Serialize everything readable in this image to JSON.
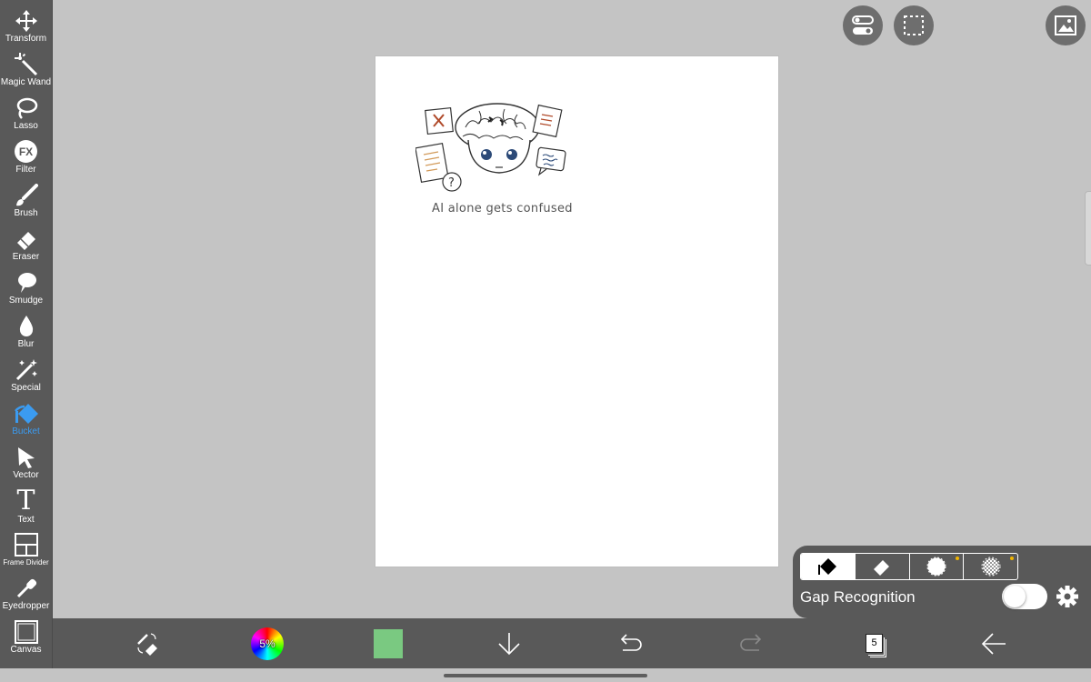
{
  "toolbar": {
    "items": [
      {
        "label": "Transform",
        "icon": "move-arrows-icon"
      },
      {
        "label": "Magic Wand",
        "icon": "magic-wand-icon"
      },
      {
        "label": "Lasso",
        "icon": "lasso-icon"
      },
      {
        "label": "Filter",
        "icon": "fx-icon"
      },
      {
        "label": "Brush",
        "icon": "brush-icon"
      },
      {
        "label": "Eraser",
        "icon": "eraser-icon"
      },
      {
        "label": "Smudge",
        "icon": "smudge-icon"
      },
      {
        "label": "Blur",
        "icon": "drop-icon"
      },
      {
        "label": "Special",
        "icon": "sparkle-wand-icon"
      },
      {
        "label": "Bucket",
        "icon": "bucket-icon",
        "active": true
      },
      {
        "label": "Vector",
        "icon": "pointer-arrow-icon"
      },
      {
        "label": "Text",
        "icon": "text-t-icon"
      },
      {
        "label": "Frame Divider",
        "icon": "frame-divider-icon"
      },
      {
        "label": "Eyedropper",
        "icon": "eyedropper-icon"
      },
      {
        "label": "Canvas",
        "icon": "canvas-square-icon"
      }
    ],
    "filter_glyph": "FX",
    "text_glyph": "T"
  },
  "top_buttons": [
    "toggle-settings-icon",
    "selection-marquee-icon",
    "image-icon"
  ],
  "canvas": {
    "caption": "AI alone gets confused"
  },
  "bucket_panel": {
    "modes": [
      "fill-mode-icon",
      "erase-fill-icon",
      "reference-layer-icon",
      "transparency-icon"
    ],
    "selected_mode": 0,
    "gap_recognition_label": "Gap Recognition",
    "gap_recognition_enabled": false
  },
  "bottom_bar": {
    "color_wheel_label": "5%",
    "current_color": "#7ac981",
    "layers_count": "5"
  },
  "colors": {
    "toolbar_bg": "#595959",
    "workspace_bg": "#c4c4c4",
    "active_tool": "#3b9bf0"
  }
}
